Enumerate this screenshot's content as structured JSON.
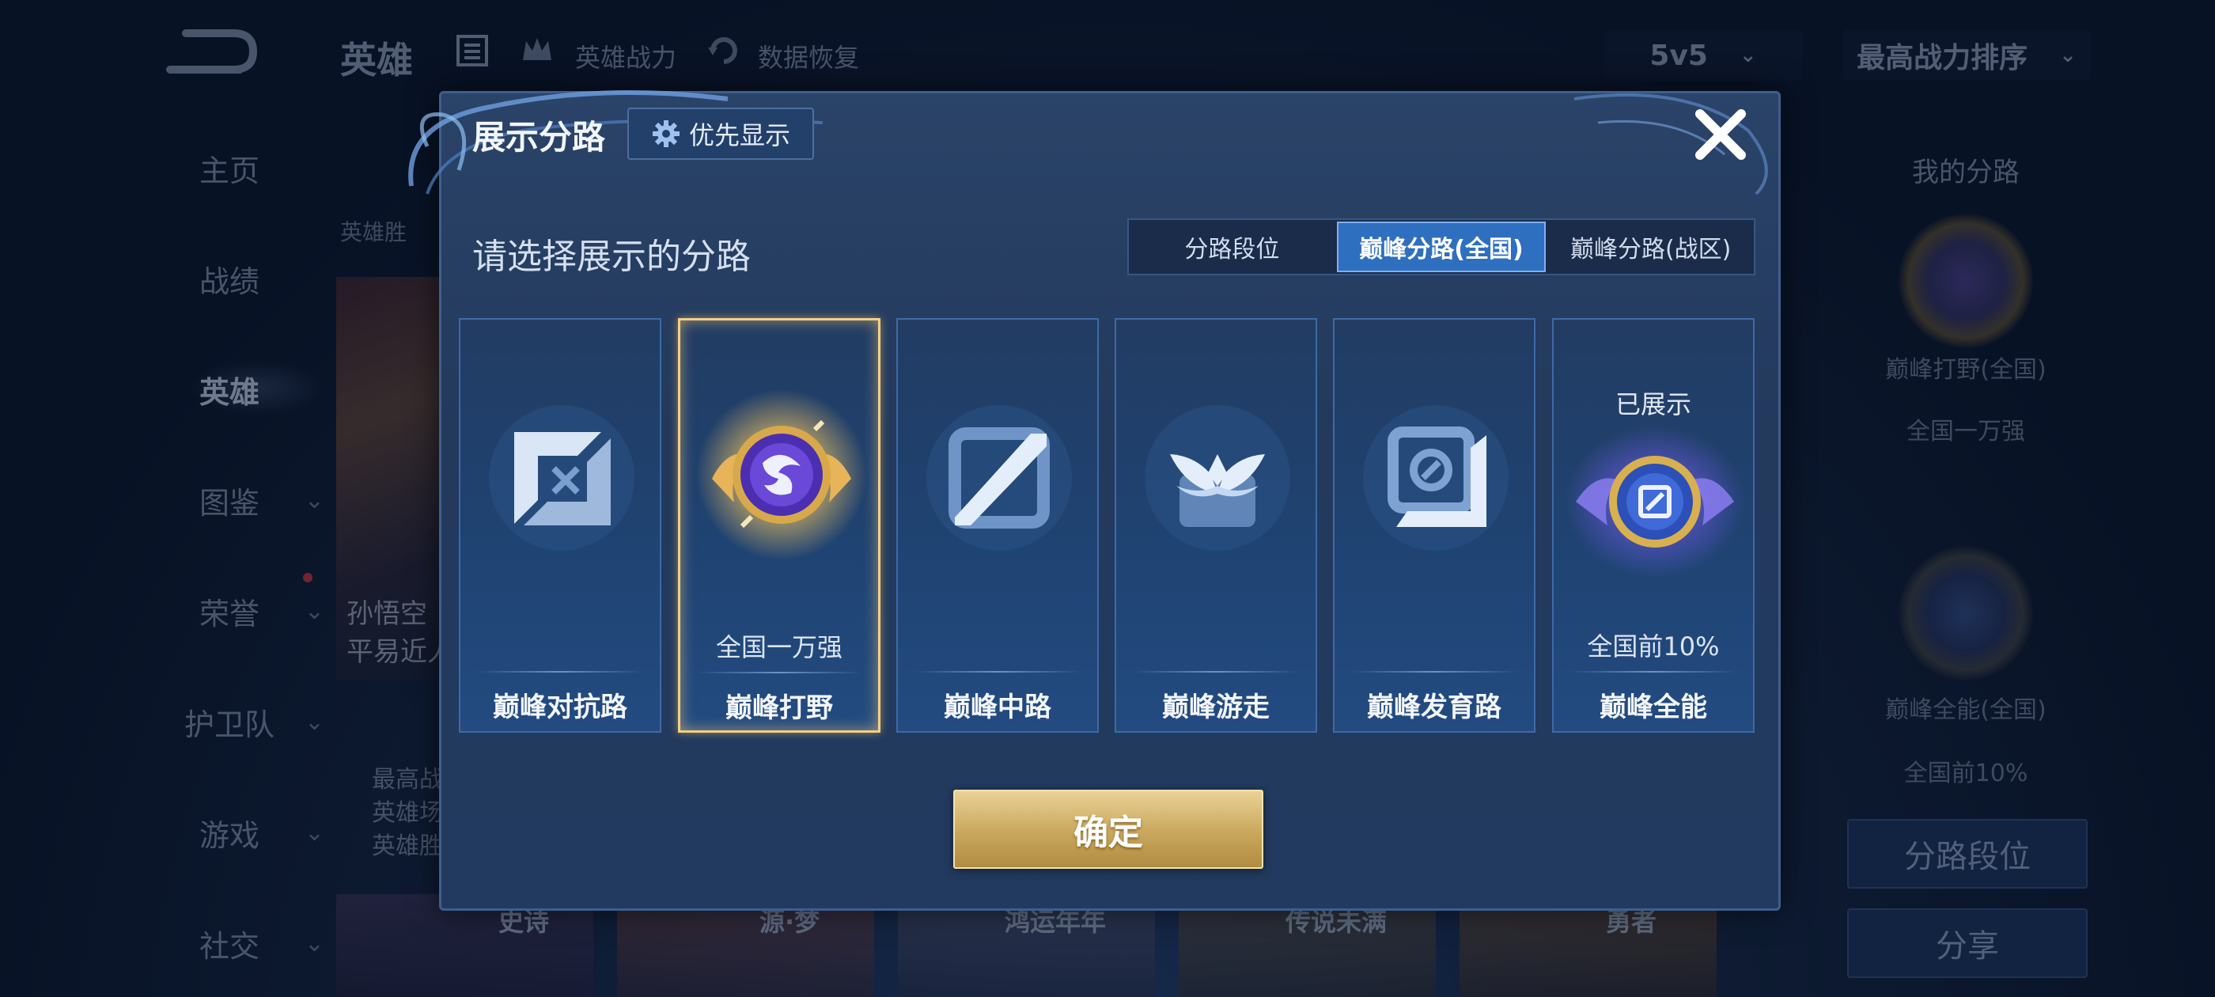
{
  "background": {
    "top_bar": {
      "title": "英雄",
      "items": [
        {
          "label": "英雄战力",
          "icon": "crown-icon"
        },
        {
          "label": "数据恢复",
          "icon": "restore-icon"
        }
      ],
      "mode_select": "5v5",
      "sort_select": "最高战力排序"
    },
    "sidebar": [
      {
        "label": "主页"
      },
      {
        "label": "战绩"
      },
      {
        "label": "英雄"
      },
      {
        "label": "图鉴"
      },
      {
        "label": "荣誉"
      },
      {
        "label": "护卫队"
      },
      {
        "label": "游戏"
      },
      {
        "label": "社交"
      }
    ],
    "hero": {
      "tab": "英雄胜",
      "name_lines": [
        "孙悟空",
        "平易近人"
      ],
      "stat_lines": [
        "最高战",
        "英雄场",
        "英雄胜"
      ]
    },
    "skin_badges": [
      "史诗",
      "源·梦",
      "鸿运年年",
      "传说未满",
      "勇者"
    ],
    "right_panel": {
      "title": "我的分路",
      "entries": [
        {
          "name": "巅峰打野(全国)",
          "rank": "全国一万强"
        },
        {
          "name": "巅峰全能(全国)",
          "rank": "全国前10%"
        }
      ],
      "buttons": [
        "分路段位",
        "分享"
      ]
    }
  },
  "modal": {
    "title": "展示分路",
    "priority_button": "优先显示",
    "subtitle": "请选择展示的分路",
    "tabs": [
      {
        "label": "分路段位"
      },
      {
        "label": "巅峰分路(全国)"
      },
      {
        "label": "巅峰分路(战区)"
      }
    ],
    "selected_tab": "巅峰分路(全国)",
    "cards": [
      {
        "name": "巅峰对抗路",
        "rank": "",
        "badge": "",
        "icon": "clash-lane-icon"
      },
      {
        "name": "巅峰打野",
        "rank": "全国一万强",
        "badge": "",
        "icon": "jungle-emblem-icon"
      },
      {
        "name": "巅峰中路",
        "rank": "",
        "badge": "",
        "icon": "mid-lane-icon"
      },
      {
        "name": "巅峰游走",
        "rank": "",
        "badge": "",
        "icon": "roam-icon"
      },
      {
        "name": "巅峰发育路",
        "rank": "",
        "badge": "",
        "icon": "farm-lane-icon"
      },
      {
        "name": "巅峰全能",
        "rank": "全国前10%",
        "badge": "已展示",
        "icon": "all-round-emblem-icon"
      }
    ],
    "selected_card": "巅峰打野",
    "confirm": "确定"
  },
  "colors": {
    "accent_blue": "#2f6fbf",
    "gold": "#c9a75c",
    "selected_border": "#f3cf82"
  }
}
